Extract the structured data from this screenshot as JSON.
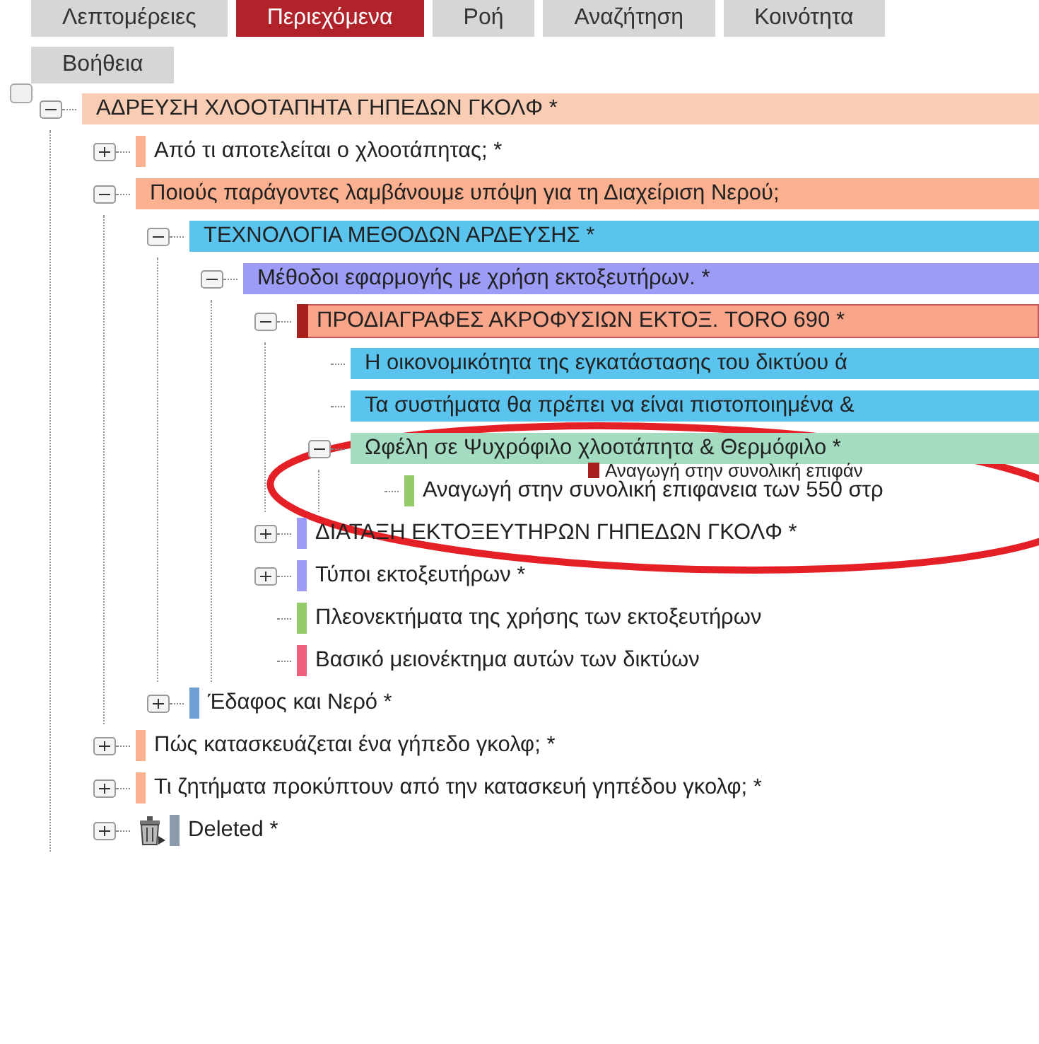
{
  "tabs": [
    {
      "label": "Λεπτομέρειες",
      "selected": false
    },
    {
      "label": "Περιεχόμενα",
      "selected": true
    },
    {
      "label": "Ροή",
      "selected": false
    },
    {
      "label": "Αναζήτηση",
      "selected": false
    },
    {
      "label": "Κοινότητα",
      "selected": false
    },
    {
      "label": "Βοήθεια",
      "selected": false
    }
  ],
  "tree_checkbox": {
    "checked": false
  },
  "tree": [
    {
      "label": "ΑΔΡΕΥΣΗ ΧΛΟΟΤΑΠΗΤΑ ΓΗΠΕΔΩΝ ΓΚΟΛΦ *",
      "kind": "filled",
      "color": "#f9cdb4",
      "expanded": true,
      "children": [
        {
          "label": "Από τι αποτελείται ο χλοοτάπητας; *",
          "kind": "tagged",
          "color": "#fbb090",
          "expanded": false
        },
        {
          "label": "Ποιούς παράγοντες λαμβάνουμε υπόψη για τη Διαχείριση Νερού;",
          "kind": "filled",
          "color": "#fbb090",
          "expanded": true,
          "children": [
            {
              "label": "ΤΕΧΝΟΛΟΓΙΑ ΜΕΘΟΔΩΝ ΑΡΔΕΥΣΗΣ *",
              "kind": "filled",
              "color": "#5bc4ee",
              "expanded": true,
              "children": [
                {
                  "label": "Μέθοδοι εφαρμογής με χρήση εκτοξευτήρων. *",
                  "kind": "filled",
                  "color": "#9c9cf6",
                  "expanded": true,
                  "children": [
                    {
                      "label": "ΠΡΟΔΙΑΓΡΑΦΕΣ ΑΚΡΟΦΥΣΙΩΝ ΕΚΤΟΞ. TORO 690 *",
                      "kind": "flagged",
                      "color": "#f9a58a",
                      "expanded": true,
                      "children": [
                        {
                          "label": "Η οικονομικότητα της εγκατάστασης του δικτύου ά",
                          "kind": "filled",
                          "color": "#5bc4ee"
                        },
                        {
                          "label": "Τα συστήματα θα πρέπει να είναι πιστοποιημένα &",
                          "kind": "filled",
                          "color": "#5bc4ee"
                        },
                        {
                          "label": "Ωφέλη σε Ψυχρόφιλο χλοοτάπητα & Θερμόφιλο *",
                          "kind": "filled",
                          "color": "#a3dcc0",
                          "expanded": true,
                          "children": [
                            {
                              "label": "Αναγωγή στην συνολική επιφανεια των 550 στρ",
                              "kind": "tagged",
                              "color": "#94cc6a"
                            }
                          ]
                        }
                      ]
                    },
                    {
                      "label": "ΔΙΑΤΑΞΗ ΕΚΤΟΞΕΥΤΗΡΩΝ ΓΗΠΕΔΩΝ ΓΚΟΛΦ *",
                      "kind": "tagged",
                      "color": "#9c9cf6",
                      "expanded": false
                    },
                    {
                      "label": "Τύποι εκτοξευτήρων *",
                      "kind": "tagged",
                      "color": "#9c9cf6",
                      "expanded": false
                    },
                    {
                      "label": "Πλεονεκτήματα της χρήσης των εκτοξευτήρων",
                      "kind": "tagged",
                      "color": "#94cc6a"
                    },
                    {
                      "label": "Βασικό μειονέκτημα αυτών των δικτύων",
                      "kind": "tagged",
                      "color": "#ee5f7e"
                    }
                  ]
                }
              ]
            },
            {
              "label": "Έδαφος και Νερό *",
              "kind": "tagged",
              "color": "#6f9fd4",
              "expanded": false
            }
          ]
        },
        {
          "label": "Πώς κατασκευάζεται ένα γήπεδο γκολφ; *",
          "kind": "tagged",
          "color": "#fbb090",
          "expanded": false
        },
        {
          "label": "Τι ζητήματα προκύπτουν από την κατασκευή γηπέδου γκολφ; *",
          "kind": "tagged",
          "color": "#fbb090",
          "expanded": false
        },
        {
          "label": "Deleted *",
          "kind": "trash",
          "color": "#8c9bab",
          "expanded": false
        }
      ]
    }
  ],
  "dragged_item": {
    "label": "Αναγωγή στην συνολική επιφάν",
    "color": "#a8201e"
  }
}
